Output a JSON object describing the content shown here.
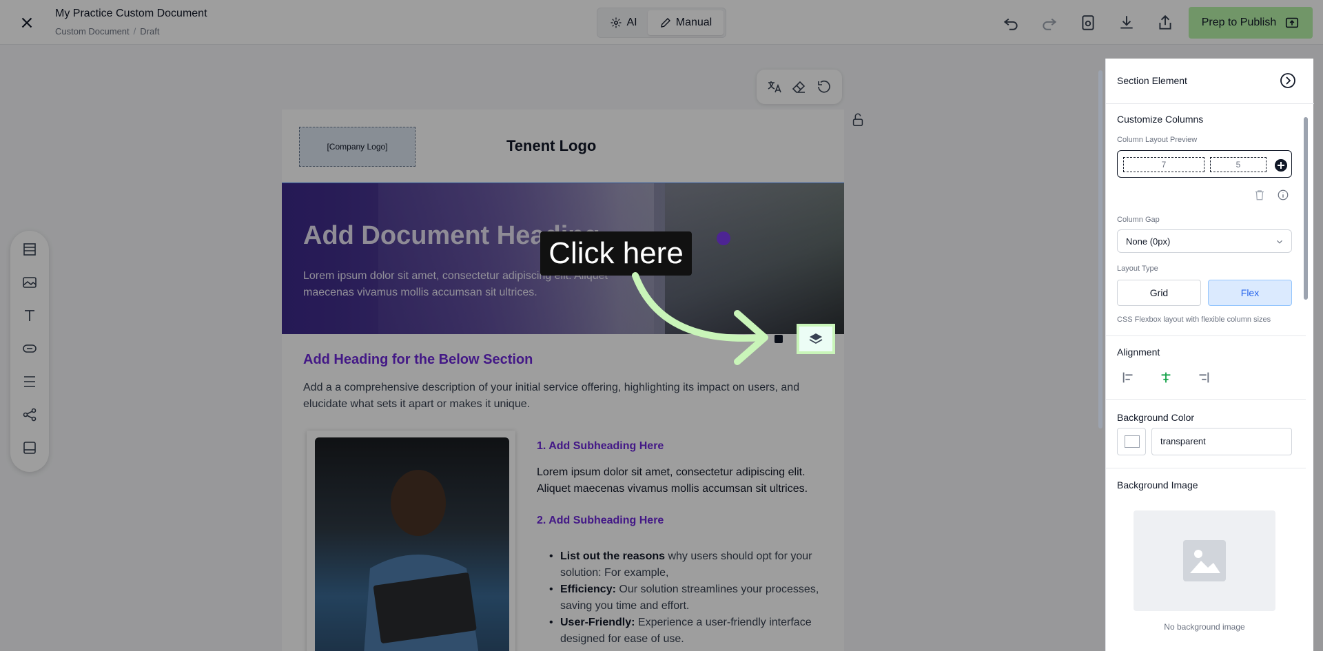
{
  "header": {
    "title": "My Practice Custom Document",
    "breadcrumb": [
      "Custom Document",
      "Draft"
    ],
    "modes": {
      "ai": "AI",
      "manual": "Manual"
    },
    "publish_label": "Prep to Publish"
  },
  "document": {
    "company_logo": "[Company Logo]",
    "tenant_logo": "Tenent Logo",
    "hero_title": "Add Document Heading",
    "hero_text": "Lorem ipsum dolor sit amet, consectetur adipiscing elit. Aliquet maecenas vivamus mollis accumsan sit ultrices.",
    "section_heading": "Add Heading for the Below Section",
    "section_desc": "Add a a comprehensive description of your initial service offering, highlighting its impact on users, and elucidate what sets it apart or makes it unique.",
    "sub1": "1. Add Subheading Here",
    "para1": "Lorem ipsum dolor sit amet, consectetur adipiscing elit. Aliquet maecenas vivamus mollis accumsan sit ultrices.",
    "sub2": "2. Add Subheading Here",
    "bullets": [
      {
        "bold": "List out the reasons",
        "text": " why users should opt for your solution: For example,"
      },
      {
        "bold": "Efficiency:",
        "text": " Our solution streamlines your processes, saving you time and effort."
      },
      {
        "bold": "User-Friendly:",
        "text": " Experience a user-friendly interface designed for ease of use."
      }
    ]
  },
  "tooltip": "Click here",
  "panel": {
    "title": "Section Element",
    "customize_columns": "Customize Columns",
    "column_layout_preview": "Column Layout Preview",
    "columns": [
      "7",
      "5"
    ],
    "column_gap_label": "Column Gap",
    "column_gap_value": "None (0px)",
    "layout_type_label": "Layout Type",
    "layout_options": [
      "Grid",
      "Flex"
    ],
    "layout_selected": "Flex",
    "layout_hint": "CSS Flexbox layout with flexible column sizes",
    "alignment_label": "Alignment",
    "bg_color_label": "Background Color",
    "bg_color_value": "transparent",
    "bg_image_label": "Background Image",
    "bg_image_caption": "No background image"
  },
  "colors": {
    "accent": "#6d28d9",
    "publish": "#b6f2a9",
    "highlight": "#c9f5b9"
  }
}
